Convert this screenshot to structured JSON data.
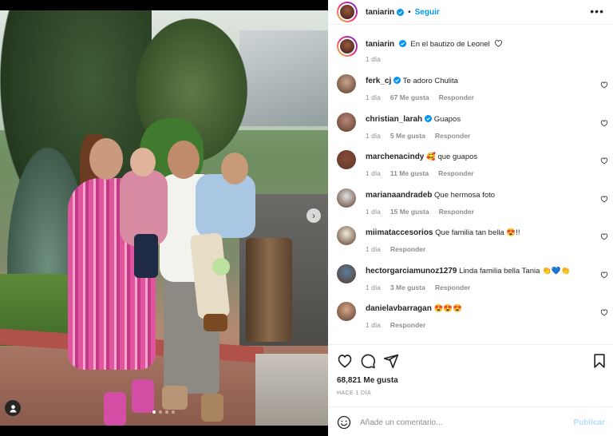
{
  "post": {
    "username": "taniarin",
    "follow_label": "Seguir",
    "caption_text": "En el bautizo de Leonel",
    "caption_time": "1 día",
    "more_icon": "more-horizontal-icon",
    "accent_color": "#0095f6",
    "carousel_dots": 4,
    "carousel_active": 0
  },
  "comments": [
    {
      "user": "ferk_cj",
      "verified": true,
      "text": "Te adoro Chulita",
      "time": "1 día",
      "likes": "67 Me gusta",
      "reply": "Responder"
    },
    {
      "user": "christian_larah",
      "verified": true,
      "text": "Guapos",
      "time": "1 día",
      "likes": "5 Me gusta",
      "reply": "Responder"
    },
    {
      "user": "marchenacindy",
      "verified": false,
      "text": "🥰 que guapos",
      "time": "1 día",
      "likes": "11 Me gusta",
      "reply": "Responder"
    },
    {
      "user": "marianaandradeb",
      "verified": false,
      "text": "Que hermosa foto",
      "time": "1 día",
      "likes": "15 Me gusta",
      "reply": "Responder"
    },
    {
      "user": "miimataccesorios",
      "verified": false,
      "text": "Que familia tan bella 😍!!",
      "time": "1 día",
      "likes": "",
      "reply": "Responder"
    },
    {
      "user": "hectorgarciamunoz1279",
      "verified": false,
      "text": "Linda familia bella Tania 👏💙👏",
      "time": "1 día",
      "likes": "3 Me gusta",
      "reply": "Responder"
    },
    {
      "user": "danielavbarragan",
      "verified": false,
      "text": "😍😍😍",
      "time": "1 día",
      "likes": "",
      "reply": "Responder"
    }
  ],
  "actions": {
    "like_icon": "heart-icon",
    "comment_icon": "comment-icon",
    "share_icon": "share-icon",
    "save_icon": "bookmark-icon",
    "likes_count": "68,821 Me gusta",
    "date_label": "HACE 1 DÍA"
  },
  "compose": {
    "emoji_icon": "emoji-icon",
    "placeholder": "Añade un comentario...",
    "publish_label": "Publicar"
  }
}
